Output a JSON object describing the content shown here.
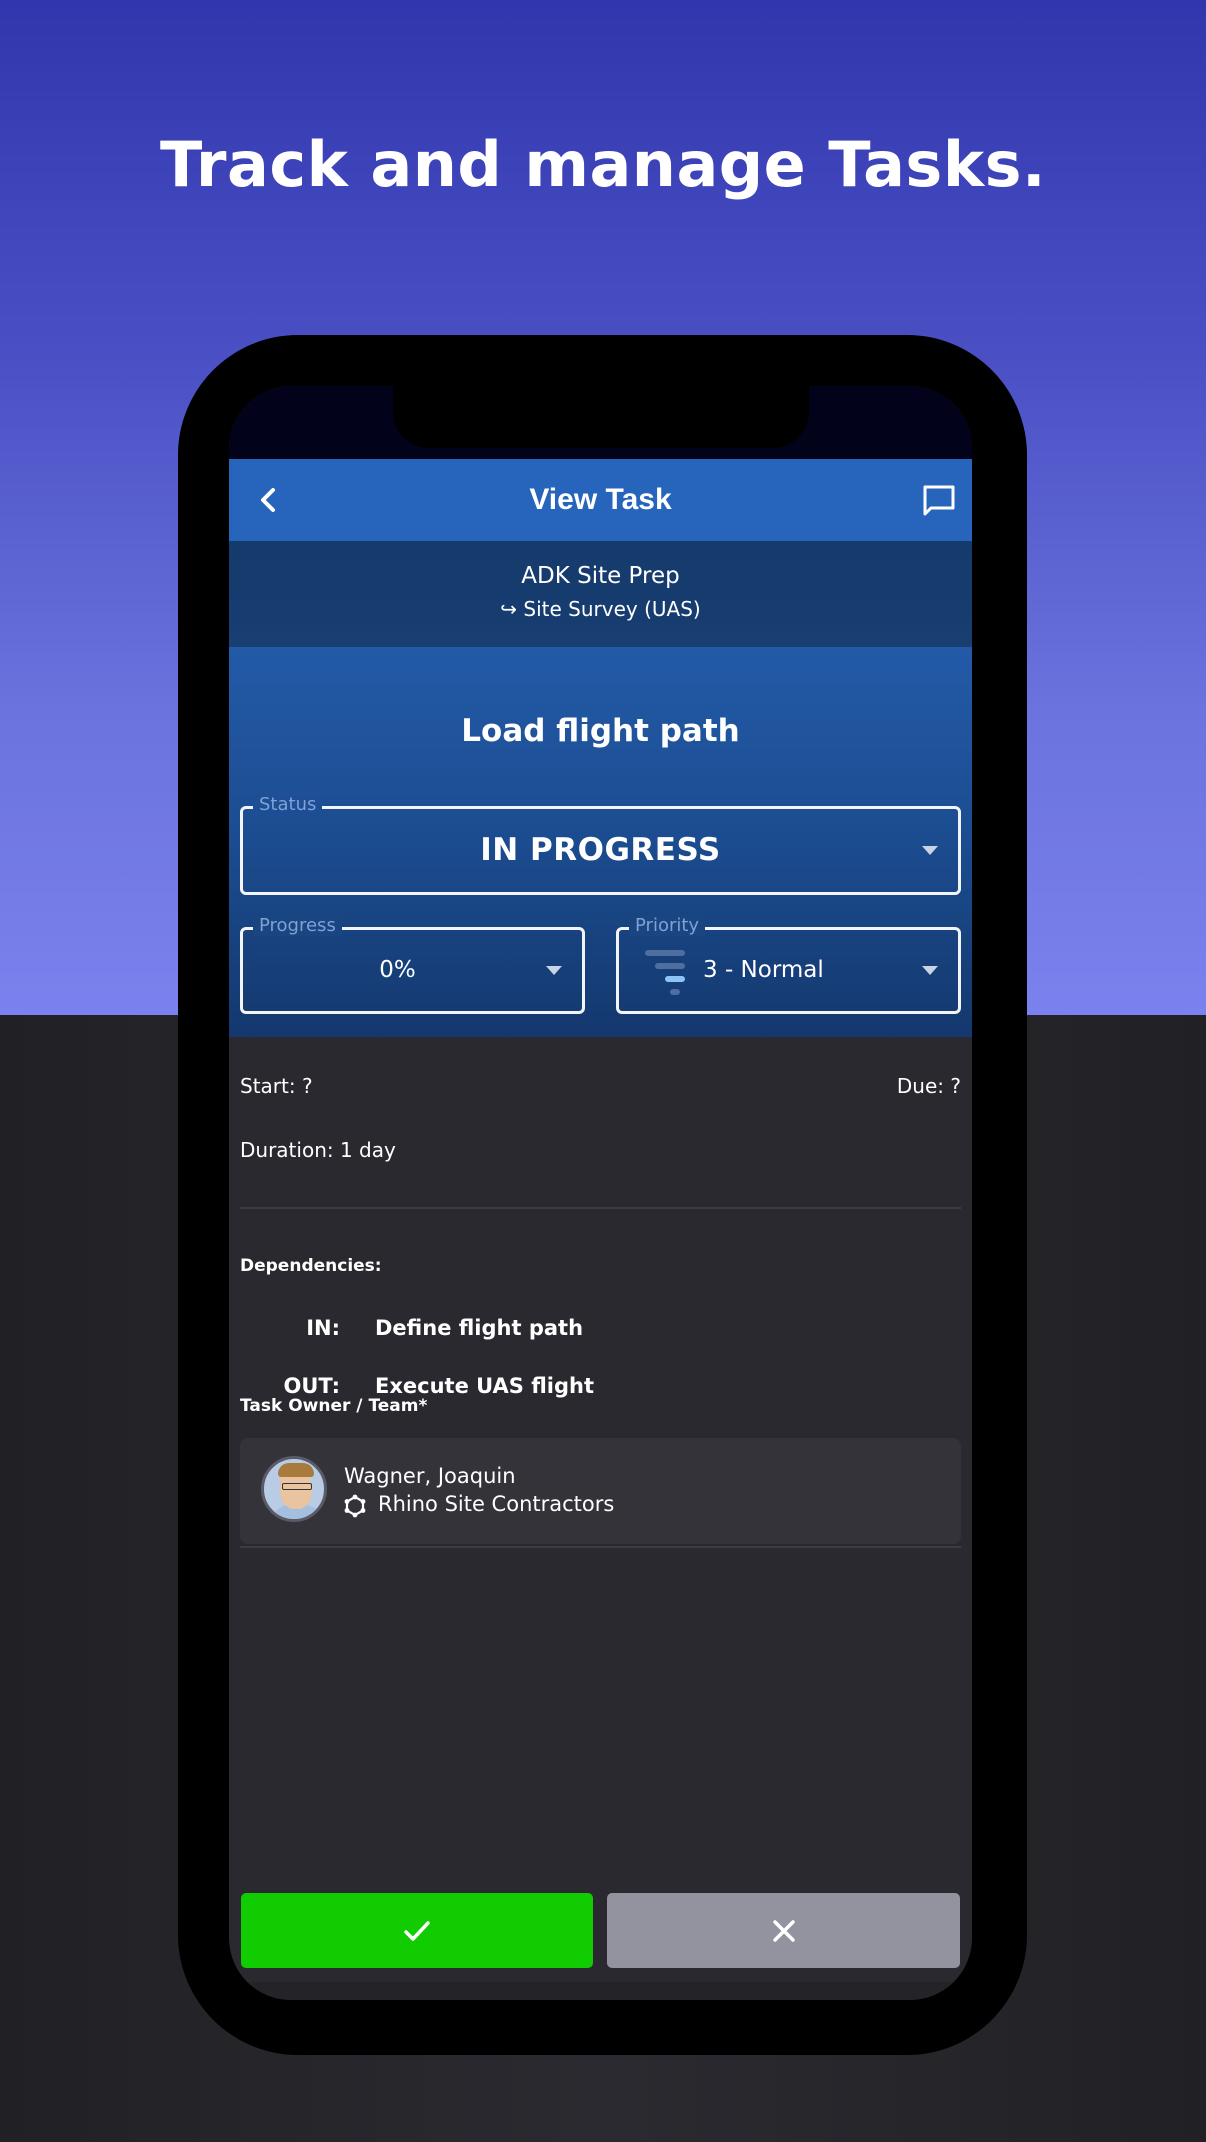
{
  "headline": "Track and manage Tasks.",
  "colors": {
    "appbar": "#2764bb",
    "confirm": "#11cc00",
    "cancel": "#93929f",
    "field_label": "#7ea2d5",
    "priority_active": "#8ec4f5"
  },
  "appbar": {
    "title": "View Task",
    "back_icon": "chevron-left-icon",
    "action_icon": "comment-icon"
  },
  "breadcrumb": {
    "project": "ADK Site Prep",
    "parent": "↪ Site Survey (UAS)"
  },
  "task": {
    "title": "Load flight path",
    "status": {
      "label": "Status",
      "value": "IN PROGRESS"
    },
    "progress": {
      "label": "Progress",
      "value": "0%",
      "percent": 0
    },
    "priority": {
      "label": "Priority",
      "value": "3 - Normal",
      "level": 3,
      "levels": 4
    }
  },
  "schedule": {
    "start": "Start: ?",
    "due": "Due: ?",
    "duration": "Duration: 1 day"
  },
  "dependencies": {
    "label": "Dependencies:",
    "items": [
      {
        "key": "IN:",
        "value": "Define flight path"
      },
      {
        "key": "OUT:",
        "value": "Execute UAS flight"
      }
    ]
  },
  "owner": {
    "label": "Task Owner / Team*",
    "name": "Wagner, Joaquin",
    "team": "Rhino Site Contractors",
    "team_icon": "team-network-icon"
  },
  "actions": {
    "confirm_icon": "check-icon",
    "cancel_icon": "close-icon"
  }
}
